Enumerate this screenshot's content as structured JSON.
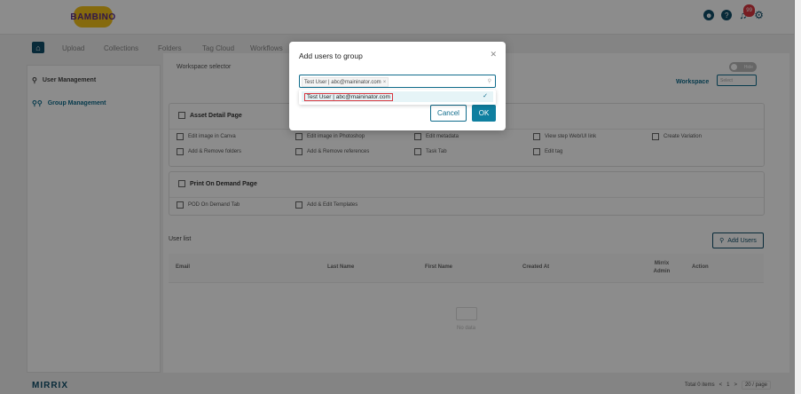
{
  "brand": {
    "logo_text": "BAMBINO",
    "footer_logo": "MIRRIX"
  },
  "topbar": {
    "notification_count": "99"
  },
  "nav": {
    "items": [
      "Upload",
      "Collections",
      "Folders",
      "Tag Cloud",
      "Workflows"
    ]
  },
  "sidebar": {
    "items": [
      {
        "label": "User Management"
      },
      {
        "label": "Group Management"
      }
    ]
  },
  "workspace": {
    "title": "Workspace selector",
    "label": "Workspace",
    "select_placeholder": "Select",
    "toggle_label": "Hide"
  },
  "asset_detail": {
    "title": "Asset Detail Page",
    "row1": [
      "Edit image in Canva",
      "Edit image in Photoshop",
      "Edit metadata",
      "View step Web/UI link",
      "Create Variation"
    ],
    "row2": [
      "Add & Remove folders",
      "Add & Remove references",
      "Task Tab",
      "Edit tag"
    ]
  },
  "print_on_demand": {
    "title": "Print On Demand Page",
    "items": [
      "POD On Demand Tab",
      "Add & Edit Templates"
    ]
  },
  "user_list": {
    "label": "User list",
    "add_button": "Add Users",
    "columns": [
      "Email",
      "Last Name",
      "First Name",
      "Created At",
      "Mirrix Admin",
      "Action"
    ],
    "empty_text": "No data"
  },
  "pagination": {
    "total": "Total 0 items",
    "prev": "<",
    "page": "1",
    "next": ">",
    "page_size": "20 / page"
  },
  "modal": {
    "title": "Add users to group",
    "selected_tag": "Test User | abc@maininator.com",
    "option": "Test User | abc@maininator.com",
    "cancel": "Cancel",
    "ok": "OK"
  }
}
